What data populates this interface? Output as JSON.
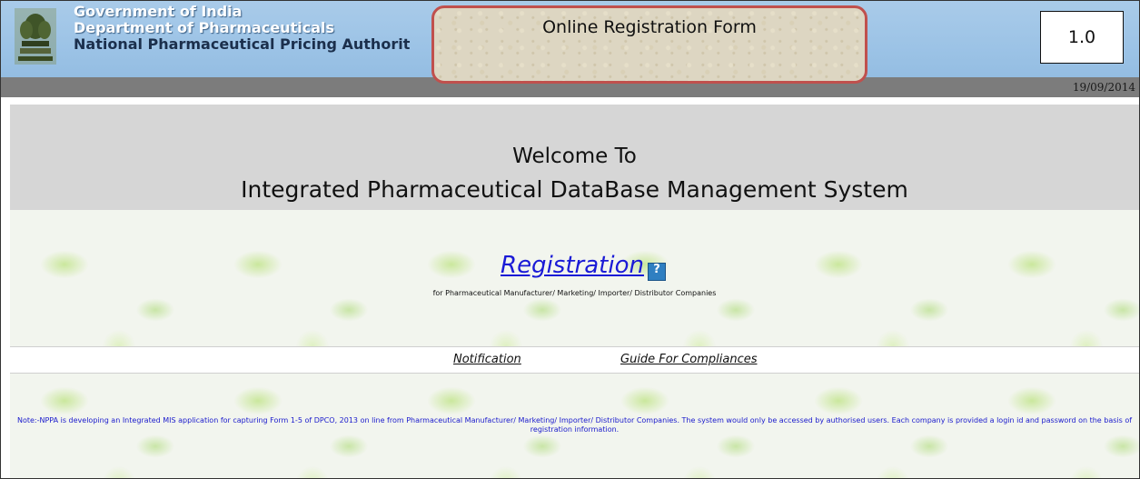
{
  "header": {
    "org_line1": "Government of India",
    "org_line2": "Department of Pharmaceuticals",
    "org_line3": "National Pharmaceutical Pricing Authorit",
    "title": "Online Registration Form",
    "version": "1.0",
    "date": "19/09/2014"
  },
  "welcome": {
    "line1": "Welcome To",
    "line2": "Integrated Pharmaceutical DataBase Management System"
  },
  "registration": {
    "link_label": "Registration",
    "help_icon_text": "?",
    "subtitle": "for Pharmaceutical Manufacturer/ Marketing/ Importer/ Distributor Companies"
  },
  "links": {
    "notification": "Notification",
    "guide": "Guide For Compliances"
  },
  "note": "Note:-NPPA is developing an Integrated MIS application for capturing Form 1-5 of DPCO, 2013 on line from Pharmaceutical Manufacturer/ Marketing/ Importer/ Distributor Companies. The system would only be accessed by authorised users. Each company is provided a login id and password on the basis of registration information.",
  "colors": {
    "header_bg": "#9cc3e6",
    "title_border": "#c0504d",
    "link_blue": "#1a1ad6",
    "note_blue": "#1a1acc"
  },
  "icons": [
    "emblem-icon",
    "help-icon"
  ]
}
